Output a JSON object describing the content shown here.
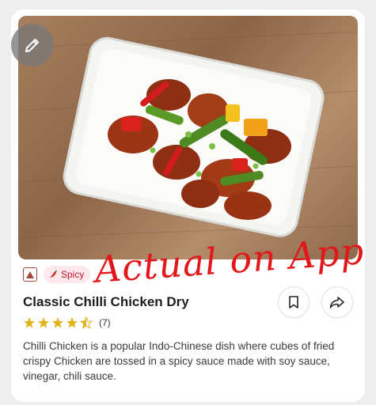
{
  "card": {
    "image_alt": "Classic Chilli Chicken Dry",
    "edit_icon": "pencil-icon",
    "diet_icon": "non-veg-triangle-icon",
    "spicy_tag": {
      "icon": "chili-pepper-icon",
      "label": "Spicy"
    },
    "overlay_annotation": "Actual on App",
    "title": "Classic Chilli Chicken Dry",
    "rating": {
      "stars": 4.5,
      "count": "(7)"
    },
    "description": "Chilli Chicken is a popular Indo-Chinese dish where cubes of fried crispy Chicken are tossed in a spicy sauce made with soy sauce, vinegar, chili sauce.",
    "bookmark_icon": "bookmark-icon",
    "share_icon": "share-icon",
    "colors": {
      "accent_red": "#c0142d",
      "star_gold": "#e0b31c",
      "annotation_red": "#e3161a"
    }
  }
}
